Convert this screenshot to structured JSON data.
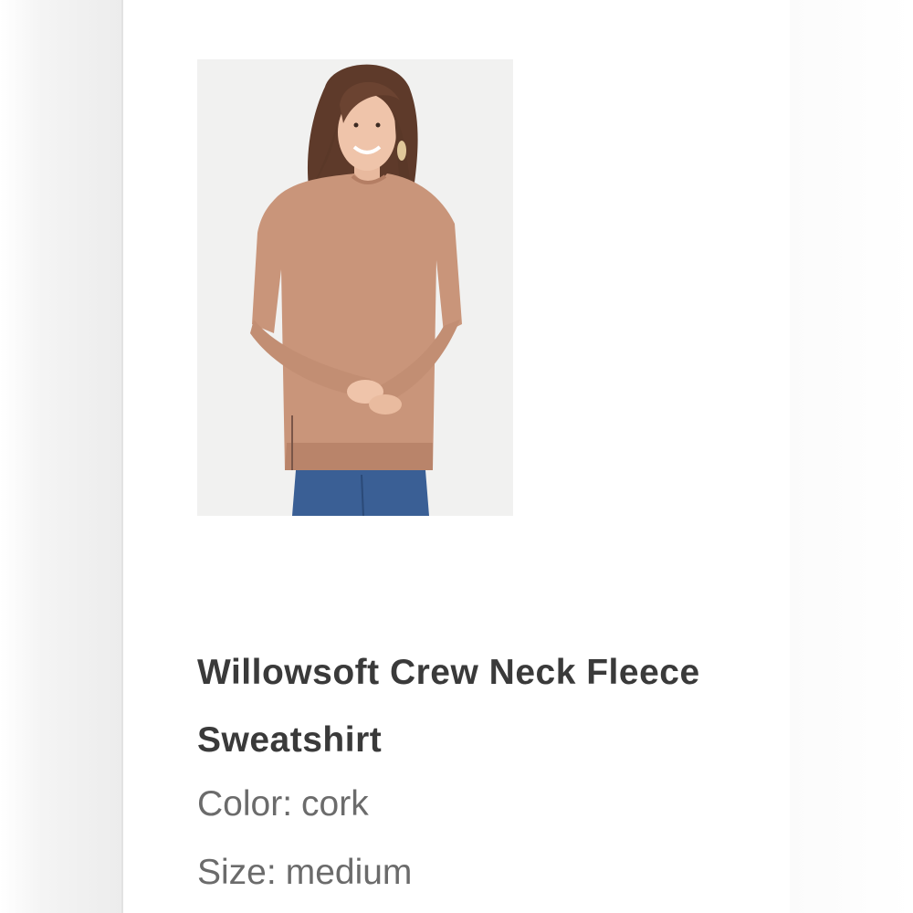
{
  "product": {
    "title": "Willowsoft Crew Neck Fleece Sweatshirt",
    "image_alt": "Model wearing the sweatshirt with blue jeans",
    "attributes": {
      "color_label": "Color:",
      "color_value": "cork",
      "size_label": "Size:",
      "size_value": "medium"
    }
  },
  "colors": {
    "title_text": "#3a3a3a",
    "attribute_text": "#6b6b6b",
    "sweatshirt": "#c9957a",
    "denim": "#3a5f95",
    "photo_background": "#f1f1f0"
  }
}
